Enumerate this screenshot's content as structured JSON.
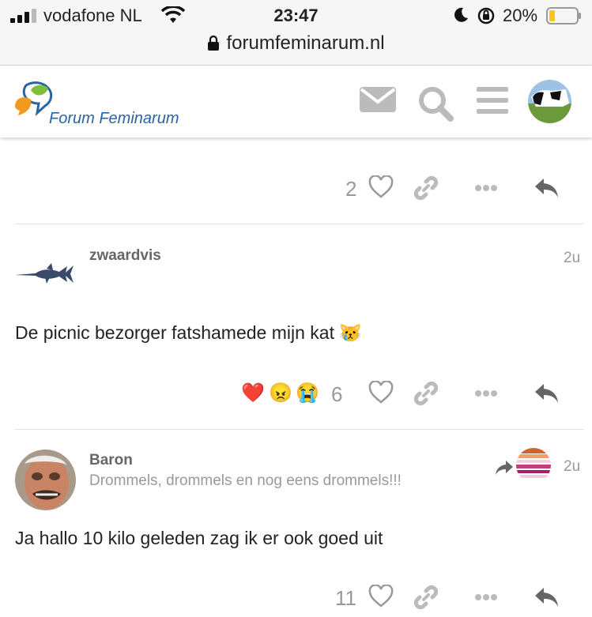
{
  "status_bar": {
    "carrier": "vodafone NL",
    "time": "23:47",
    "battery": "20%",
    "url": "forumfeminarum.nl"
  },
  "header": {
    "site_name": "Forum Feminarum",
    "icons": [
      "envelope-icon",
      "search-icon",
      "hamburger-menu-icon",
      "user-avatar"
    ]
  },
  "posts": [
    {
      "likes": "2"
    },
    {
      "username": "zwaardvis",
      "age": "2u",
      "content": "De picnic bezorger fatshamede mijn kat 😿",
      "reactions": [
        "❤️",
        "😠",
        "😭"
      ],
      "likes": "6"
    },
    {
      "username": "Baron",
      "user_title": "Drommels, drommels en nog eens drommels!!!",
      "age": "2u",
      "content": "Ja hallo 10 kilo geleden zag ik er ook goed uit",
      "likes": "11"
    }
  ],
  "colors": {
    "logo_blue": "#2a64a6",
    "icon_gray": "#bbbbbb",
    "reply_gray": "#666666",
    "heart_red": "#e0242b"
  }
}
